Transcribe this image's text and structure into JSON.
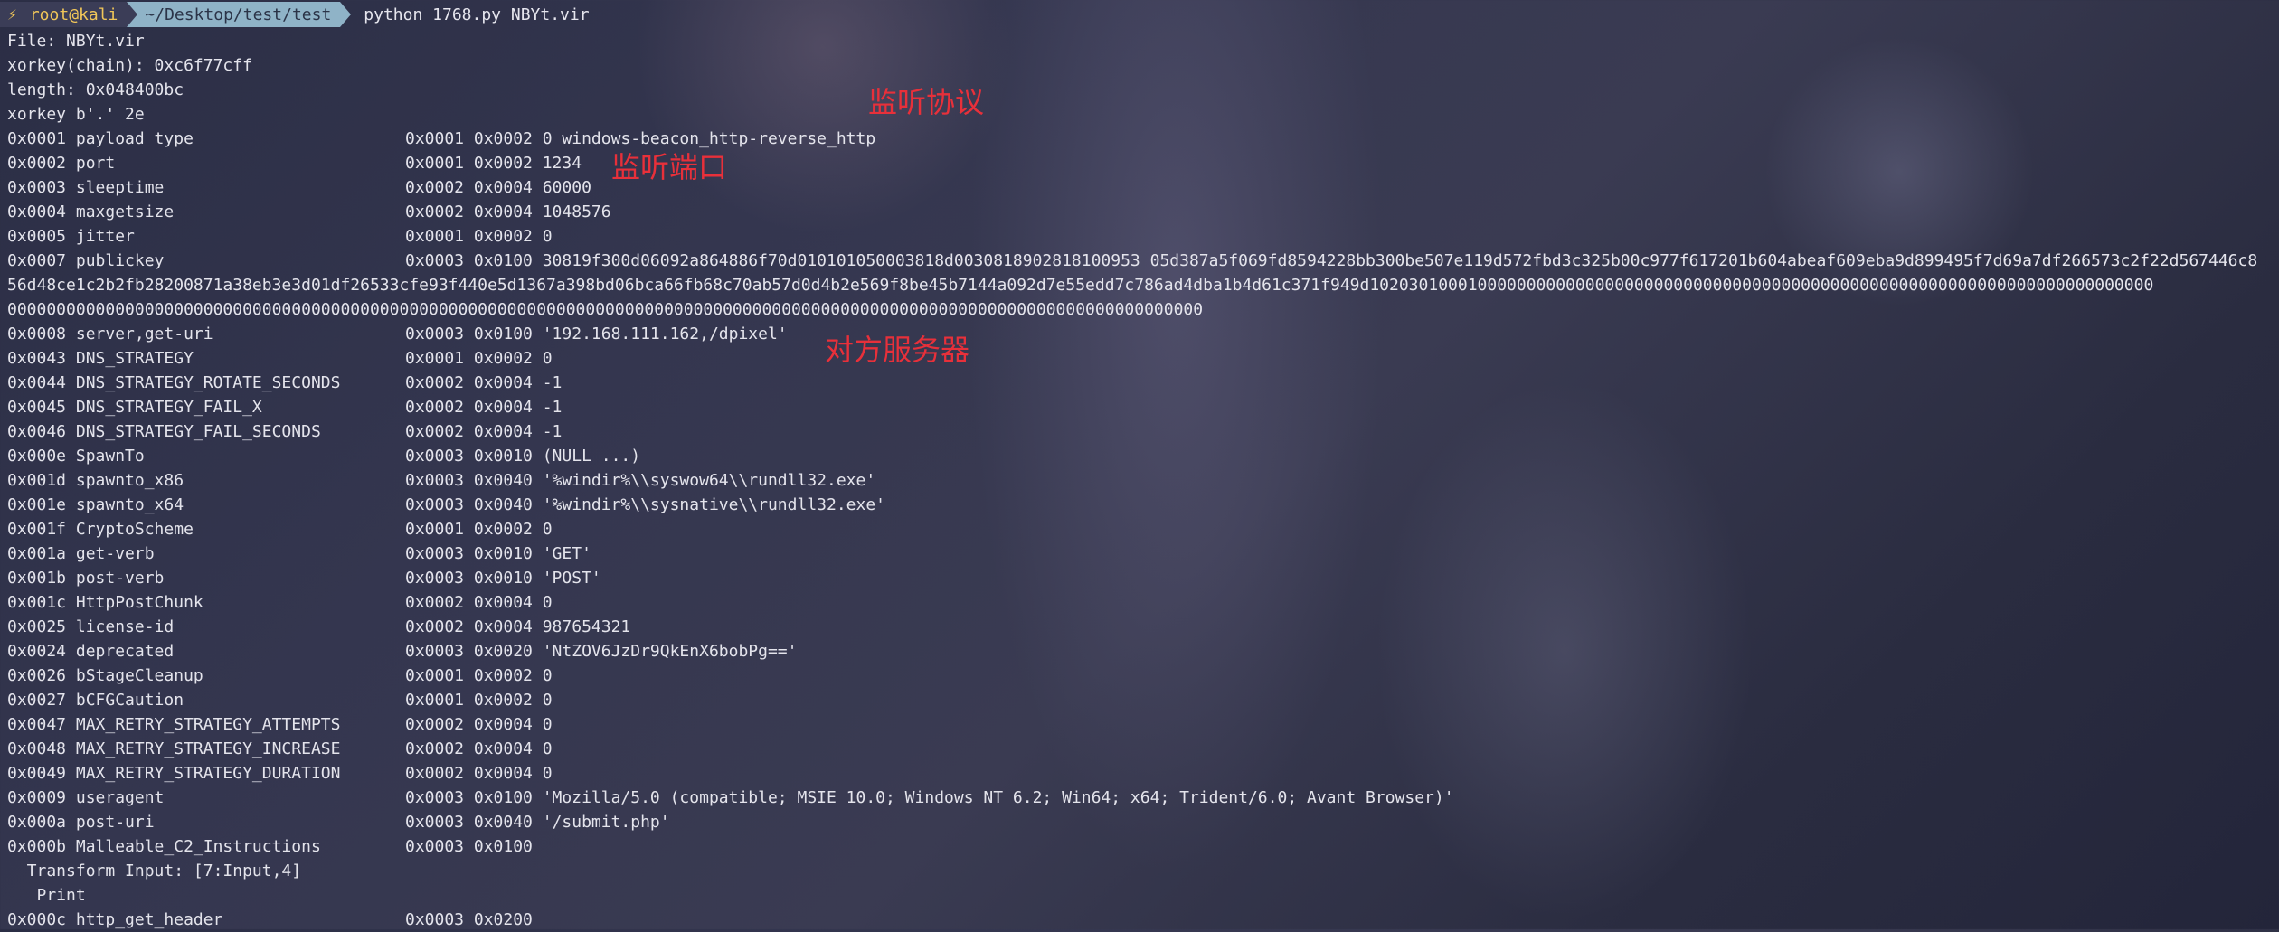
{
  "prompt": {
    "user": "root@kali",
    "path": "~/Desktop/test/test",
    "command": "python 1768.py NBYt.vir"
  },
  "header_lines": [
    "File: NBYt.vir",
    "xorkey(chain): 0xc6f77cff",
    "length: 0x048400bc",
    "xorkey b'.' 2e"
  ],
  "entries": [
    {
      "key": "0x0001 payload type",
      "value": "0x0001 0x0002 0 windows-beacon_http-reverse_http"
    },
    {
      "key": "0x0002 port",
      "value": "0x0001 0x0002 1234"
    },
    {
      "key": "0x0003 sleeptime",
      "value": "0x0002 0x0004 60000"
    },
    {
      "key": "0x0004 maxgetsize",
      "value": "0x0002 0x0004 1048576"
    },
    {
      "key": "0x0005 jitter",
      "value": "0x0001 0x0002 0"
    },
    {
      "key": "0x0007 publickey",
      "value": "0x0003 0x0100 30819f300d06092a864886f70d010101050003818d0030818902818100953 05d387a5f069fd8594228bb300be507e119d572fbd3c325b00c977f617201b604abeaf609eba9d899495f7d69a7df266573c2f22d567446c8"
    },
    {
      "key": "56d48ce1c2b2fb28200871a38eb3e3d01df26533cfe93f440e5d1367a398bd06bca66fb68c70ab57d0d4b2e569f8be45b7144a092d7e55edd7c786ad4dba1b4d61c371f949d10203010001000000000000000000000000000000000000000000000000000000000000000000000",
      "value": ""
    },
    {
      "key": "00000000000000000000000000000000000000000000000000000000000000000000000000000000000000000000000000000000000000000000000000",
      "value": ""
    },
    {
      "key": "0x0008 server,get-uri",
      "value": "0x0003 0x0100 '192.168.111.162,/dpixel'"
    },
    {
      "key": "0x0043 DNS_STRATEGY",
      "value": "0x0001 0x0002 0"
    },
    {
      "key": "0x0044 DNS_STRATEGY_ROTATE_SECONDS",
      "value": "0x0002 0x0004 -1"
    },
    {
      "key": "0x0045 DNS_STRATEGY_FAIL_X",
      "value": "0x0002 0x0004 -1"
    },
    {
      "key": "0x0046 DNS_STRATEGY_FAIL_SECONDS",
      "value": "0x0002 0x0004 -1"
    },
    {
      "key": "0x000e SpawnTo",
      "value": "0x0003 0x0010 (NULL ...)"
    },
    {
      "key": "0x001d spawnto_x86",
      "value": "0x0003 0x0040 '%windir%\\\\syswow64\\\\rundll32.exe'"
    },
    {
      "key": "0x001e spawnto_x64",
      "value": "0x0003 0x0040 '%windir%\\\\sysnative\\\\rundll32.exe'"
    },
    {
      "key": "0x001f CryptoScheme",
      "value": "0x0001 0x0002 0"
    },
    {
      "key": "0x001a get-verb",
      "value": "0x0003 0x0010 'GET'"
    },
    {
      "key": "0x001b post-verb",
      "value": "0x0003 0x0010 'POST'"
    },
    {
      "key": "0x001c HttpPostChunk",
      "value": "0x0002 0x0004 0"
    },
    {
      "key": "0x0025 license-id",
      "value": "0x0002 0x0004 987654321"
    },
    {
      "key": "0x0024 deprecated",
      "value": "0x0003 0x0020 'NtZOV6JzDr9QkEnX6bobPg=='"
    },
    {
      "key": "0x0026 bStageCleanup",
      "value": "0x0001 0x0002 0"
    },
    {
      "key": "0x0027 bCFGCaution",
      "value": "0x0001 0x0002 0"
    },
    {
      "key": "0x0047 MAX_RETRY_STRATEGY_ATTEMPTS",
      "value": "0x0002 0x0004 0"
    },
    {
      "key": "0x0048 MAX_RETRY_STRATEGY_INCREASE",
      "value": "0x0002 0x0004 0"
    },
    {
      "key": "0x0049 MAX_RETRY_STRATEGY_DURATION",
      "value": "0x0002 0x0004 0"
    },
    {
      "key": "0x0009 useragent",
      "value": "0x0003 0x0100 'Mozilla/5.0 (compatible; MSIE 10.0; Windows NT 6.2; Win64; x64; Trident/6.0; Avant Browser)'"
    },
    {
      "key": "0x000a post-uri",
      "value": "0x0003 0x0040 '/submit.php'"
    },
    {
      "key": "0x000b Malleable_C2_Instructions",
      "value": "0x0003 0x0100"
    },
    {
      "key": "  Transform Input: [7:Input,4]",
      "value": ""
    },
    {
      "key": "   Print",
      "value": ""
    },
    {
      "key": "0x000c http_get_header",
      "value": "0x0003 0x0200"
    }
  ],
  "annotations": {
    "protocol": "监听协议",
    "port": "监听端口",
    "server": "对方服务器"
  }
}
